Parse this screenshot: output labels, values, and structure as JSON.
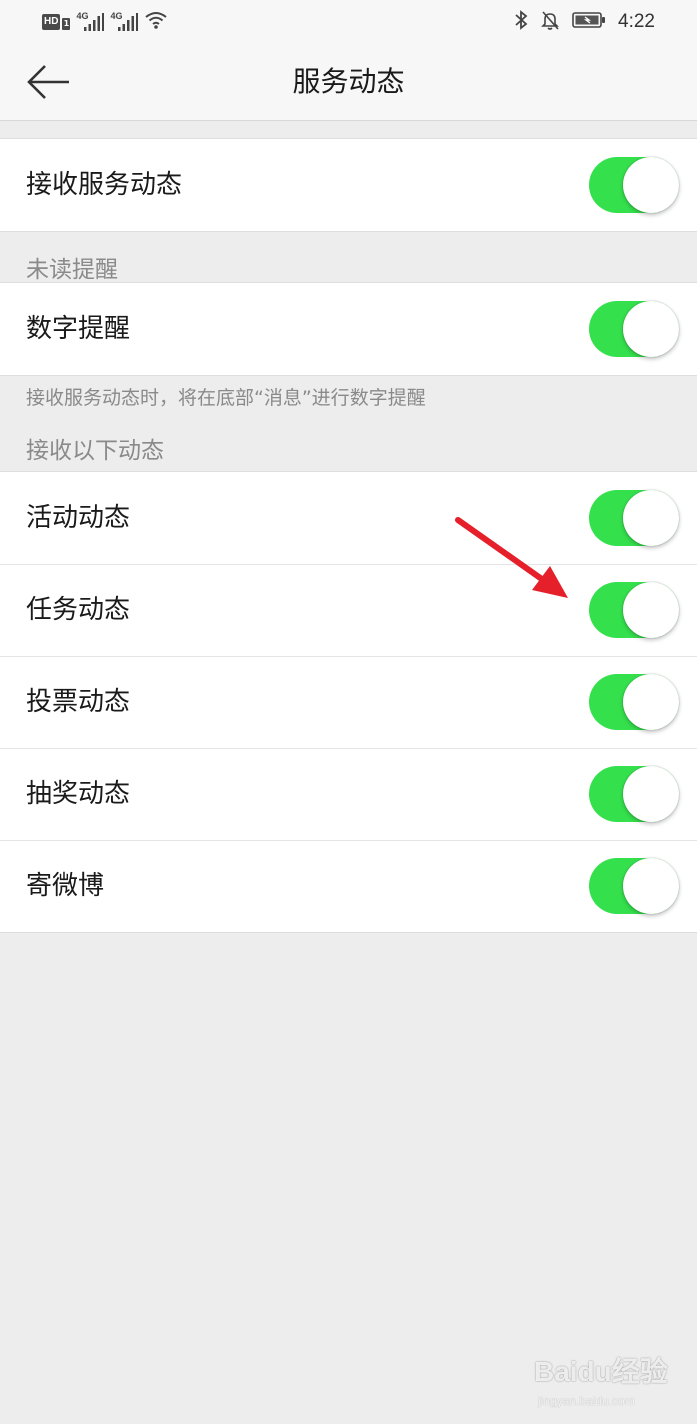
{
  "status_bar": {
    "hd_label": "HD",
    "sim_label": "1",
    "network_1": "4G",
    "network_2": "4G",
    "time": "4:22",
    "icons": [
      "signal-icon",
      "wifi-icon",
      "bluetooth-icon",
      "mute-bell-icon",
      "battery-icon"
    ]
  },
  "nav": {
    "title": "服务动态",
    "back_icon": "back-arrow-icon"
  },
  "groups": {
    "main": {
      "items": [
        {
          "label": "接收服务动态",
          "enabled": true
        }
      ]
    },
    "unread": {
      "header": "未读提醒",
      "items": [
        {
          "label": "数字提醒",
          "enabled": true
        }
      ],
      "hint": "接收服务动态时，将在底部“消息”进行数字提醒"
    },
    "feeds": {
      "header": "接收以下动态",
      "items": [
        {
          "label": "活动动态",
          "enabled": true
        },
        {
          "label": "任务动态",
          "enabled": true
        },
        {
          "label": "投票动态",
          "enabled": true
        },
        {
          "label": "抽奖动态",
          "enabled": true
        },
        {
          "label": "寄微博",
          "enabled": true
        }
      ]
    }
  },
  "colors": {
    "toggle_on": "#35e04d",
    "annotation_arrow": "#e5202a"
  },
  "watermark": {
    "logo": "Baidu经验",
    "url": "jingyan.baidu.com"
  }
}
